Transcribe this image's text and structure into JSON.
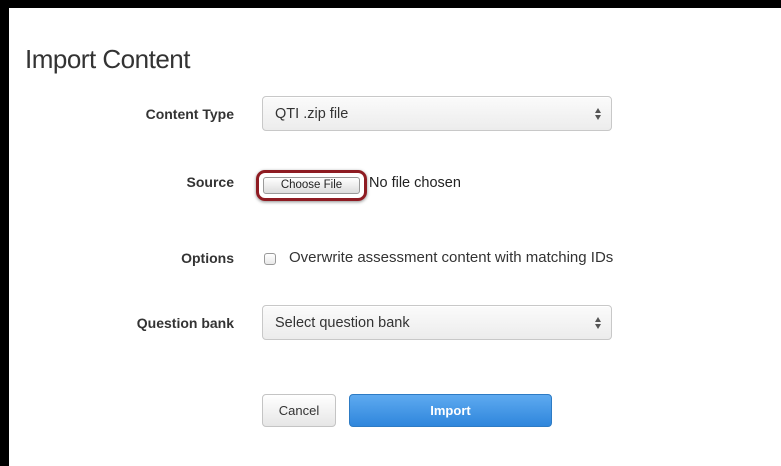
{
  "dialog": {
    "title": "Import Content"
  },
  "content_type": {
    "label": "Content Type",
    "selected": "QTI .zip file"
  },
  "source": {
    "label": "Source",
    "choose_file_label": "Choose File",
    "file_status": "No file chosen"
  },
  "options": {
    "label": "Options",
    "overwrite_label": "Overwrite assessment content with matching IDs",
    "overwrite_checked": false
  },
  "question_bank": {
    "label": "Question bank",
    "selected": "Select question bank"
  },
  "actions": {
    "cancel_label": "Cancel",
    "import_label": "Import"
  },
  "colors": {
    "highlight_ring": "#8e1b22",
    "import_button": "#3a8fe0"
  }
}
